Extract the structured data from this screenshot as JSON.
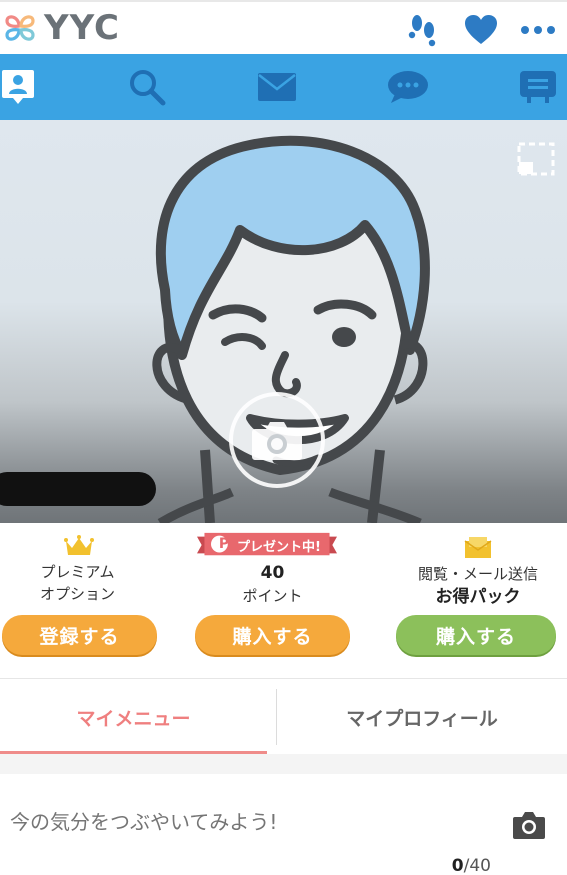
{
  "app": {
    "logo_text": "YYC"
  },
  "header": {
    "icons": [
      "footprints-icon",
      "heart-icon",
      "more-dots-icon"
    ],
    "accent_color": "#3aa3e3"
  },
  "nav": {
    "items": [
      "profile-icon",
      "search-icon",
      "mail-icon",
      "chat-bubble-icon",
      "board-icon"
    ]
  },
  "photo": {
    "overlay_icon": "camera-icon",
    "expand_icon": "fullscreen-icon"
  },
  "purchase": {
    "premium": {
      "line1": "プレミアム",
      "line2": "オプション",
      "button": "登録する",
      "icon": "crown-icon"
    },
    "points": {
      "ribbon": "プレゼント中!",
      "ribbon_badge": "P",
      "value": "40",
      "unit": "ポイント",
      "button": "購入する"
    },
    "pack": {
      "line1": "閲覧・メール送信",
      "line2": "お得パック",
      "button": "購入する",
      "icon": "mail-pack-icon"
    }
  },
  "tabs": {
    "my_menu": "マイメニュー",
    "my_profile": "マイプロフィール"
  },
  "post": {
    "placeholder": "今の気分をつぶやいてみよう!",
    "count_current": "0",
    "count_max": "/40"
  }
}
